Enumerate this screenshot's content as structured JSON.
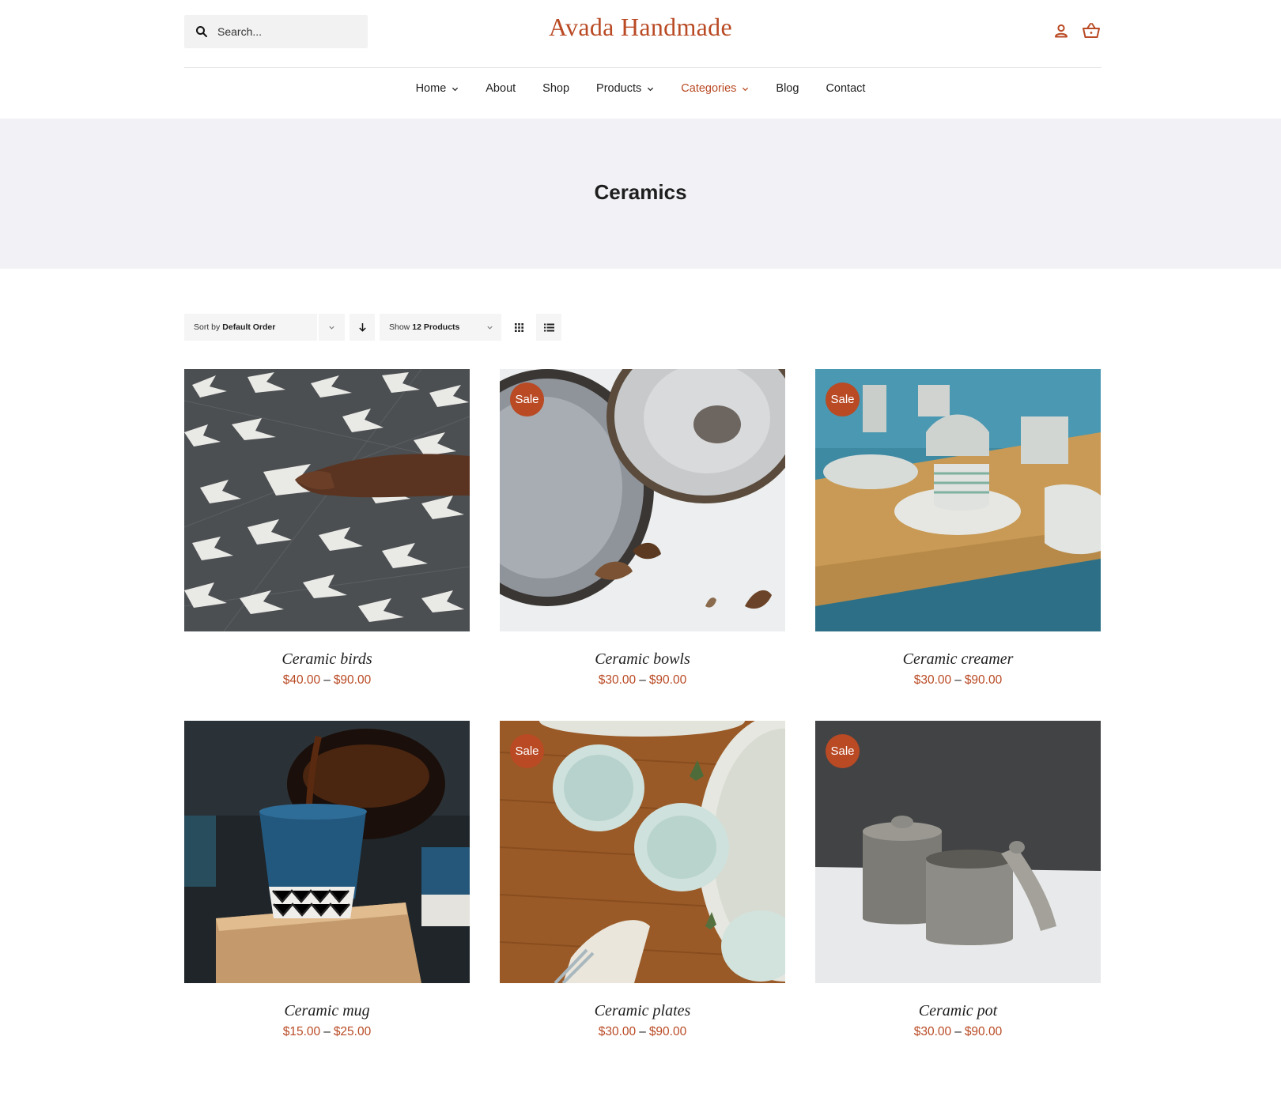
{
  "header": {
    "search_placeholder": "Search...",
    "logo": "Avada Handmade"
  },
  "nav": {
    "items": [
      {
        "label": "Home",
        "has_dropdown": true,
        "active": false
      },
      {
        "label": "About",
        "has_dropdown": false,
        "active": false
      },
      {
        "label": "Shop",
        "has_dropdown": false,
        "active": false
      },
      {
        "label": "Products",
        "has_dropdown": true,
        "active": false
      },
      {
        "label": "Categories",
        "has_dropdown": true,
        "active": true
      },
      {
        "label": "Blog",
        "has_dropdown": false,
        "active": false
      },
      {
        "label": "Contact",
        "has_dropdown": false,
        "active": false
      }
    ]
  },
  "page": {
    "title": "Ceramics"
  },
  "toolbar": {
    "sort_prefix": "Sort by",
    "sort_value": "Default Order",
    "show_prefix": "Show",
    "show_value": "12 Products"
  },
  "products": [
    {
      "name": "Ceramic birds",
      "price_min": "$40.00",
      "price_max": "$90.00",
      "sale": false
    },
    {
      "name": "Ceramic bowls",
      "price_min": "$30.00",
      "price_max": "$90.00",
      "sale": true
    },
    {
      "name": "Ceramic creamer",
      "price_min": "$30.00",
      "price_max": "$90.00",
      "sale": true
    },
    {
      "name": "Ceramic mug",
      "price_min": "$15.00",
      "price_max": "$25.00",
      "sale": false
    },
    {
      "name": "Ceramic plates",
      "price_min": "$30.00",
      "price_max": "$90.00",
      "sale": true
    },
    {
      "name": "Ceramic pot",
      "price_min": "$30.00",
      "price_max": "$90.00",
      "sale": true
    }
  ],
  "badge_label": "Sale",
  "price_separator": "–",
  "colors": {
    "accent": "#b94a24",
    "band": "#f2f2f6",
    "control_bg": "#f5f5f5"
  }
}
